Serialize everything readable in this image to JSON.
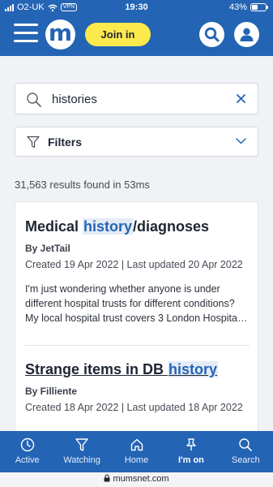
{
  "status_bar": {
    "carrier": "O2-UK",
    "vpn": "VPN",
    "time": "19:30",
    "battery": "43%",
    "battery_level": 0.43
  },
  "header": {
    "logo": "m",
    "join_label": "Join in",
    "icons": [
      "menu-icon",
      "search-icon",
      "user-icon"
    ]
  },
  "search": {
    "value": "histories",
    "icons": [
      "search-icon",
      "close-icon"
    ]
  },
  "filters": {
    "label": "Filters",
    "icons": [
      "filter-icon",
      "chevron-down-icon"
    ]
  },
  "results_count": "31,563 results found in 53ms",
  "results": [
    {
      "title_before": "Medical ",
      "title_highlight": "history",
      "title_after": "/diagnoses",
      "author": "By JetTail",
      "dates": "Created 19 Apr 2022 | Last updated 20 Apr 2022",
      "snippet": "I'm just wondering whether anyone is under different hospital trusts for different conditions? My local hospital trust covers 3 London Hospita…"
    },
    {
      "title_before": "Strange items in DB ",
      "title_highlight": "history",
      "title_after": "",
      "author": "By Filliente",
      "dates": "Created 18 Apr 2022 | Last updated 18 Apr 2022"
    }
  ],
  "bottom_nav": [
    {
      "label": "Active",
      "icon": "clock-icon"
    },
    {
      "label": "Watching",
      "icon": "filter-icon"
    },
    {
      "label": "Home",
      "icon": "home-icon"
    },
    {
      "label": "I'm on",
      "icon": "pin-icon",
      "active": true
    },
    {
      "label": "Search",
      "icon": "search-icon"
    }
  ],
  "url": "mumsnet.com",
  "colors": {
    "brand": "#2464b4",
    "join_button": "#fce94c",
    "page_bg": "#f0f2f5"
  }
}
